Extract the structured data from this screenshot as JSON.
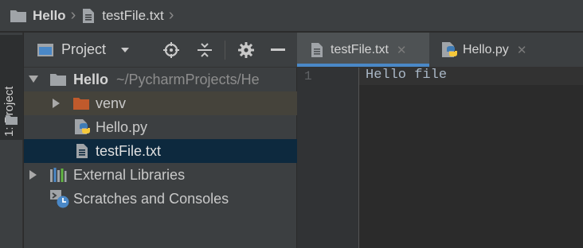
{
  "breadcrumb": {
    "items": [
      {
        "label": "Hello",
        "icon": "folder-icon"
      },
      {
        "label": "testFile.txt",
        "icon": "text-file-icon"
      }
    ]
  },
  "toolwindow": {
    "tab_label": "1: Project",
    "view_mode": "Project"
  },
  "tree": {
    "root": {
      "label": "Hello",
      "path": "~/PycharmProjects/He"
    },
    "children": [
      {
        "label": "venv",
        "icon": "folder-orange-icon"
      },
      {
        "label": "Hello.py",
        "icon": "python-file-icon"
      },
      {
        "label": "testFile.txt",
        "icon": "text-file-icon",
        "selected": true
      }
    ],
    "external_libraries": "External Libraries",
    "scratches": "Scratches and Consoles"
  },
  "editor": {
    "tabs": [
      {
        "label": "testFile.txt",
        "active": true,
        "icon": "text-file-icon"
      },
      {
        "label": "Hello.py",
        "active": false,
        "icon": "python-file-icon"
      }
    ],
    "line_number": "1",
    "content": "Hello file"
  },
  "colors": {
    "background": "#2b2b2b",
    "panel": "#3c3f41",
    "selection": "#0d293e",
    "accent": "#4a88c7",
    "folder_orange": "#c05a2c"
  }
}
